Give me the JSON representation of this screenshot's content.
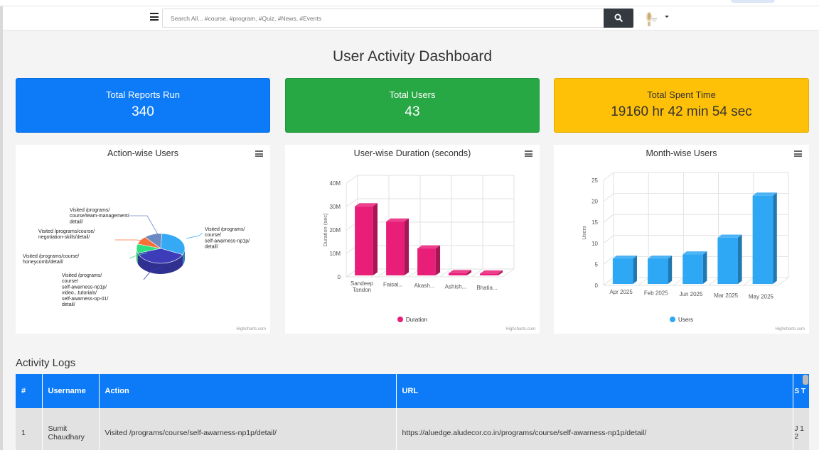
{
  "search": {
    "placeholder": "Search All... #course, #program, #Quiz, #News, #Events"
  },
  "icons": {
    "menu": "hamburger-icon",
    "search": "search-icon",
    "avatar": "avatar",
    "caret": "caret-down-icon",
    "chart_menu": "chart-menu-icon"
  },
  "page_title": "User Activity Dashboard",
  "stats": [
    {
      "label": "Total Reports Run",
      "value": "340",
      "color": "#0d7bf7"
    },
    {
      "label": "Total Users",
      "value": "43",
      "color": "#28a745"
    },
    {
      "label": "Total Spent Time",
      "value": "19160 hr 42 min 54 sec",
      "color": "#ffc107"
    }
  ],
  "credit": "Highcharts.com",
  "chart_data": [
    {
      "type": "pie",
      "title": "Action-wise Users",
      "slices": [
        {
          "label": "Visited /programs/course/self-awarness-np1p/detail/",
          "value": 31,
          "color": "#36a9f5"
        },
        {
          "label": "Visited /programs/course/self-awarness-np1p/video...tutorials/self-awarness-op-01/detail/",
          "value": 38,
          "color": "#3d3dba"
        },
        {
          "label": "Visited /programs/course/honeycomb/detail/",
          "value": 10,
          "color": "#2fe080"
        },
        {
          "label": "Visited /programs/course/negotiation-skills/detail/",
          "value": 9,
          "color": "#f7703a"
        },
        {
          "label": "Visited /programs/course/team-management/detail/",
          "value": 12,
          "color": "#6c89c2"
        }
      ]
    },
    {
      "type": "bar",
      "title": "User-wise Duration (seconds)",
      "categories": [
        "Sandeep Tandon",
        "Faisal...",
        "Akash...",
        "Ashish...",
        "Bhatia..."
      ],
      "series": [
        {
          "name": "Duration",
          "values": [
            29500000,
            23000000,
            11500000,
            1000000,
            800000
          ],
          "color": "#e91e78"
        }
      ],
      "ylabel": "Duration (sec)",
      "yticks": [
        "0",
        "10M",
        "20M",
        "30M",
        "40M"
      ],
      "ylim": [
        0,
        40000000
      ]
    },
    {
      "type": "bar",
      "title": "Month-wise Users",
      "categories": [
        "Apr 2025",
        "Feb 2025",
        "Jun 2025",
        "Mar 2025",
        "May 2025"
      ],
      "series": [
        {
          "name": "Users",
          "values": [
            6,
            6,
            7,
            11,
            21
          ],
          "color": "#2ea7f5"
        }
      ],
      "ylabel": "Users",
      "yticks": [
        "0",
        "5",
        "10",
        "15",
        "20",
        "25"
      ],
      "ylim": [
        0,
        25
      ]
    }
  ],
  "activity": {
    "title": "Activity Logs",
    "columns": [
      "#",
      "Username",
      "Action",
      "URL",
      "S T"
    ],
    "rows": [
      [
        "1",
        "Sumit Chaudhary",
        "Visited /programs/course/self-awarness-np1p/detail/",
        "https://aluedge.aludecor.co.in/programs/course/self-awarness-np1p/detail/",
        "J 1 2"
      ]
    ]
  }
}
